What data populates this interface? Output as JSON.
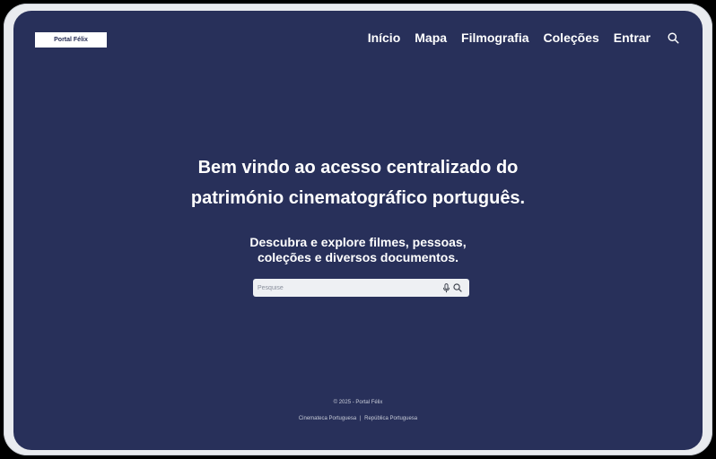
{
  "brand": {
    "logo_text": "Portal Félix"
  },
  "nav": {
    "items": [
      {
        "label": "Início"
      },
      {
        "label": "Mapa"
      },
      {
        "label": "Filmografia"
      },
      {
        "label": "Coleções"
      },
      {
        "label": "Entrar"
      }
    ],
    "search_icon": "search-icon"
  },
  "hero": {
    "title_line1": "Bem vindo ao acesso centralizado do",
    "title_line2": "património cinematográfico português.",
    "subtitle_line1": "Descubra e explore filmes, pessoas,",
    "subtitle_line2": "coleções e diversos documentos."
  },
  "search": {
    "placeholder": "Pesquise",
    "value": "",
    "icons": [
      "microphone-icon",
      "search-icon"
    ]
  },
  "footer": {
    "copyright": "© 2025 - Portal Félix",
    "links": [
      {
        "label": "Cinemateca Portuguesa"
      },
      {
        "label": "República Portuguesa"
      }
    ],
    "separator": "|"
  },
  "colors": {
    "background": "#28305a",
    "device_frame": "#e9ebef",
    "text": "#ffffff",
    "search_box": "#eef0f3"
  }
}
